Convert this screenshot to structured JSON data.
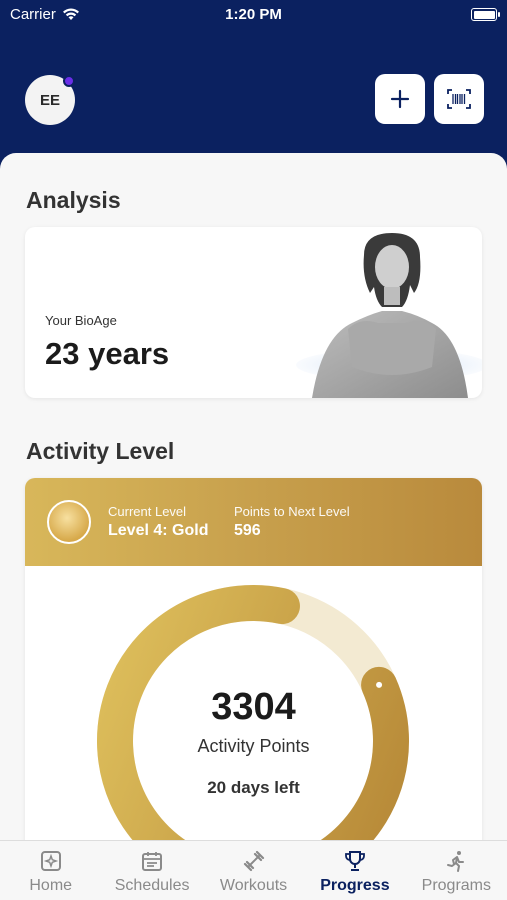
{
  "status_bar": {
    "carrier": "Carrier",
    "time": "1:20 PM"
  },
  "header": {
    "avatar_initials": "EE",
    "add_icon": "plus-icon",
    "scan_icon": "barcode-scan-icon"
  },
  "analysis": {
    "title": "Analysis",
    "bioage_label": "Your BioAge",
    "bioage_value": "23 years"
  },
  "activity": {
    "title": "Activity Level",
    "current_level_label": "Current Level",
    "current_level_value": "Level 4: Gold",
    "next_level_label": "Points to Next Level",
    "next_level_value": "596",
    "points_value": "3304",
    "points_label": "Activity Points",
    "days_left": "20 days left",
    "progress_fraction": 0.85
  },
  "colors": {
    "header_navy": "#0b2160",
    "gold": "#c9a24e",
    "accent_purple": "#6a2ee8"
  },
  "tab_bar": {
    "items": [
      {
        "label": "Home",
        "icon": "home-icon",
        "active": false
      },
      {
        "label": "Schedules",
        "icon": "calendar-icon",
        "active": false
      },
      {
        "label": "Workouts",
        "icon": "dumbbell-icon",
        "active": false
      },
      {
        "label": "Progress",
        "icon": "trophy-icon",
        "active": true
      },
      {
        "label": "Programs",
        "icon": "running-icon",
        "active": false
      }
    ]
  }
}
